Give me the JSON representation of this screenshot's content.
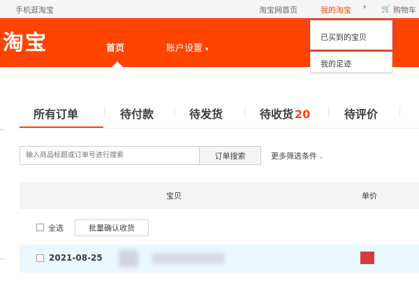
{
  "topbar": {
    "mobile_taobao": "手机逛淘宝",
    "taobao_home": "淘宝网首页",
    "my_taobao": "我的淘宝",
    "cart": "购物车"
  },
  "header": {
    "logo": "淘宝",
    "nav": [
      "首页",
      "账户设置"
    ]
  },
  "dropdown": {
    "items": [
      "已买到的宝贝",
      "我的足迹"
    ]
  },
  "tabs": [
    {
      "label": "所有订单",
      "count": ""
    },
    {
      "label": "待付款",
      "count": ""
    },
    {
      "label": "待发货",
      "count": ""
    },
    {
      "label": "待收货",
      "count": "20"
    },
    {
      "label": "待评价",
      "count": ""
    }
  ],
  "search": {
    "placeholder": "输入商品标题或订单号进行搜索",
    "button": "订单搜索",
    "more_filters": "更多筛选条件"
  },
  "table": {
    "headers": [
      "宝贝",
      "单价"
    ]
  },
  "toolbar": {
    "select_all": "全选",
    "batch_confirm": "批量确认收货"
  },
  "order": {
    "date": "2021-08-25"
  },
  "colors": {
    "brand": "#ff4400",
    "highlight": "#e8412c",
    "row_bg": "#eaf8ff"
  }
}
